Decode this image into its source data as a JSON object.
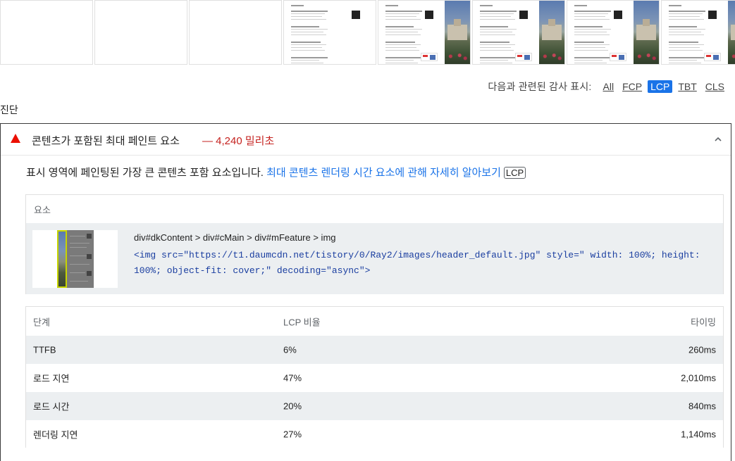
{
  "filmstrip": {
    "frames": [
      {
        "state": "blank"
      },
      {
        "state": "blank"
      },
      {
        "state": "blank"
      },
      {
        "state": "partial"
      },
      {
        "state": "loaded"
      },
      {
        "state": "loaded"
      },
      {
        "state": "loaded"
      },
      {
        "state": "loaded"
      }
    ]
  },
  "filter": {
    "label": "다음과 관련된 감사 표시:",
    "buttons": [
      {
        "label": "All",
        "active": false
      },
      {
        "label": "FCP",
        "active": false
      },
      {
        "label": "LCP",
        "active": true
      },
      {
        "label": "TBT",
        "active": false
      },
      {
        "label": "CLS",
        "active": false
      }
    ]
  },
  "section": {
    "title": "진단"
  },
  "audit": {
    "title": "콘텐츠가 포함된 최대 페인트 요소",
    "value": "— 4,240 밀리초",
    "status_color": "#eb0f00",
    "description": "표시 영역에 페인팅된 가장 큰 콘텐츠 포함 요소입니다.",
    "learn_more": "최대 콘텐츠 렌더링 시간 요소에 관해 자세히 알아보기",
    "tag": "LCP",
    "element_table": {
      "header": "요소",
      "path": "div#dkContent > div#cMain > div#mFeature > img",
      "snippet": "<img src=\"https://t1.daumcdn.net/tistory/0/Ray2/images/header_default.jpg\" style=\" width: 100%; height: 100%; object-fit: cover;\" decoding=\"async\">"
    },
    "phase_table": {
      "headers": [
        "단계",
        "LCP 비율",
        "타이밍"
      ],
      "rows": [
        [
          "TTFB",
          "6%",
          "260ms"
        ],
        [
          "로드 지연",
          "47%",
          "2,010ms"
        ],
        [
          "로드 시간",
          "20%",
          "840ms"
        ],
        [
          "렌더링 지연",
          "27%",
          "1,140ms"
        ]
      ]
    }
  }
}
